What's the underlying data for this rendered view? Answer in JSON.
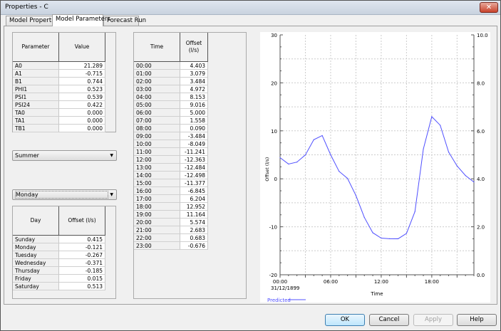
{
  "window": {
    "title": "Properties - C",
    "close": "✕"
  },
  "tabs": [
    {
      "label": "Model Properties"
    },
    {
      "label": "Model Parameters"
    },
    {
      "label": "Forecast Run"
    }
  ],
  "params": {
    "headers": [
      "Parameter",
      "Value"
    ],
    "rows": [
      [
        "A0",
        "21.289"
      ],
      [
        "A1",
        "-0.715"
      ],
      [
        "B1",
        "0.744"
      ],
      [
        "PHI1",
        "0.523"
      ],
      [
        "PSI1",
        "0.539"
      ],
      [
        "PSI24",
        "0.422"
      ],
      [
        "TA0",
        "0.000"
      ],
      [
        "TA1",
        "0.000"
      ],
      [
        "TB1",
        "0.000"
      ]
    ]
  },
  "season_select": {
    "value": "Summer"
  },
  "day_select": {
    "value": "Monday"
  },
  "days": {
    "headers": [
      "Day",
      "Offset (l/s)"
    ],
    "rows": [
      [
        "Sunday",
        "0.415"
      ],
      [
        "Monday",
        "-0.121"
      ],
      [
        "Tuesday",
        "-0.267"
      ],
      [
        "Wednesday",
        "-0.371"
      ],
      [
        "Thursday",
        "-0.185"
      ],
      [
        "Friday",
        "0.015"
      ],
      [
        "Saturday",
        "0.513"
      ]
    ]
  },
  "times": {
    "headers": [
      "Time",
      "Offset\n(l/s)"
    ],
    "rows": [
      [
        "00:00",
        "4.403"
      ],
      [
        "01:00",
        "3.079"
      ],
      [
        "02:00",
        "3.484"
      ],
      [
        "03:00",
        "4.972"
      ],
      [
        "04:00",
        "8.153"
      ],
      [
        "05:00",
        "9.016"
      ],
      [
        "06:00",
        "5.000"
      ],
      [
        "07:00",
        "1.558"
      ],
      [
        "08:00",
        "0.090"
      ],
      [
        "09:00",
        "-3.484"
      ],
      [
        "10:00",
        "-8.049"
      ],
      [
        "11:00",
        "-11.241"
      ],
      [
        "12:00",
        "-12.363"
      ],
      [
        "13:00",
        "-12.484"
      ],
      [
        "14:00",
        "-12.498"
      ],
      [
        "15:00",
        "-11.377"
      ],
      [
        "16:00",
        "-6.845"
      ],
      [
        "17:00",
        "6.204"
      ],
      [
        "18:00",
        "12.952"
      ],
      [
        "19:00",
        "11.164"
      ],
      [
        "20:00",
        "5.574"
      ],
      [
        "21:00",
        "2.683"
      ],
      [
        "22:00",
        "0.683"
      ],
      [
        "23:00",
        "-0.676"
      ]
    ]
  },
  "chart_data": {
    "type": "line",
    "xlabel": "Time",
    "ylabel": "Offset (l/s)",
    "x": [
      0,
      1,
      2,
      3,
      4,
      5,
      6,
      7,
      8,
      9,
      10,
      11,
      12,
      13,
      14,
      15,
      16,
      17,
      18,
      19,
      20,
      21,
      22,
      23
    ],
    "series": [
      {
        "name": "Predicted",
        "color": "#5050ff",
        "values": [
          4.403,
          3.079,
          3.484,
          4.972,
          8.153,
          9.016,
          5.0,
          1.558,
          0.09,
          -3.484,
          -8.049,
          -11.241,
          -12.363,
          -12.484,
          -12.498,
          -11.377,
          -6.845,
          6.204,
          12.952,
          11.164,
          5.574,
          2.683,
          0.683,
          -0.676
        ]
      }
    ],
    "xlim": [
      0,
      23
    ],
    "ylim": [
      -20,
      30
    ],
    "y2lim": [
      0,
      10
    ],
    "x_ticks": [
      {
        "v": 0,
        "label": "00:00"
      },
      {
        "v": 6,
        "label": "06:00"
      },
      {
        "v": 12,
        "label": "12:00"
      },
      {
        "v": 18,
        "label": "18:00"
      }
    ],
    "x_sublabel": "31/12/1899",
    "y_ticks": [
      "30",
      "20",
      "10",
      "0",
      "-10",
      "-20"
    ],
    "y_tick_values": [
      30,
      20,
      10,
      0,
      -10,
      -20
    ],
    "y2_ticks": [
      "10.0",
      "8.0",
      "6.0",
      "4.0",
      "2.0",
      "0.0"
    ],
    "y2_tick_values": [
      10,
      8,
      6,
      4,
      2,
      0
    ],
    "grid": true,
    "legend": "bottom-left"
  },
  "buttons": {
    "ok": "OK",
    "cancel": "Cancel",
    "apply": "Apply",
    "help": "Help"
  }
}
